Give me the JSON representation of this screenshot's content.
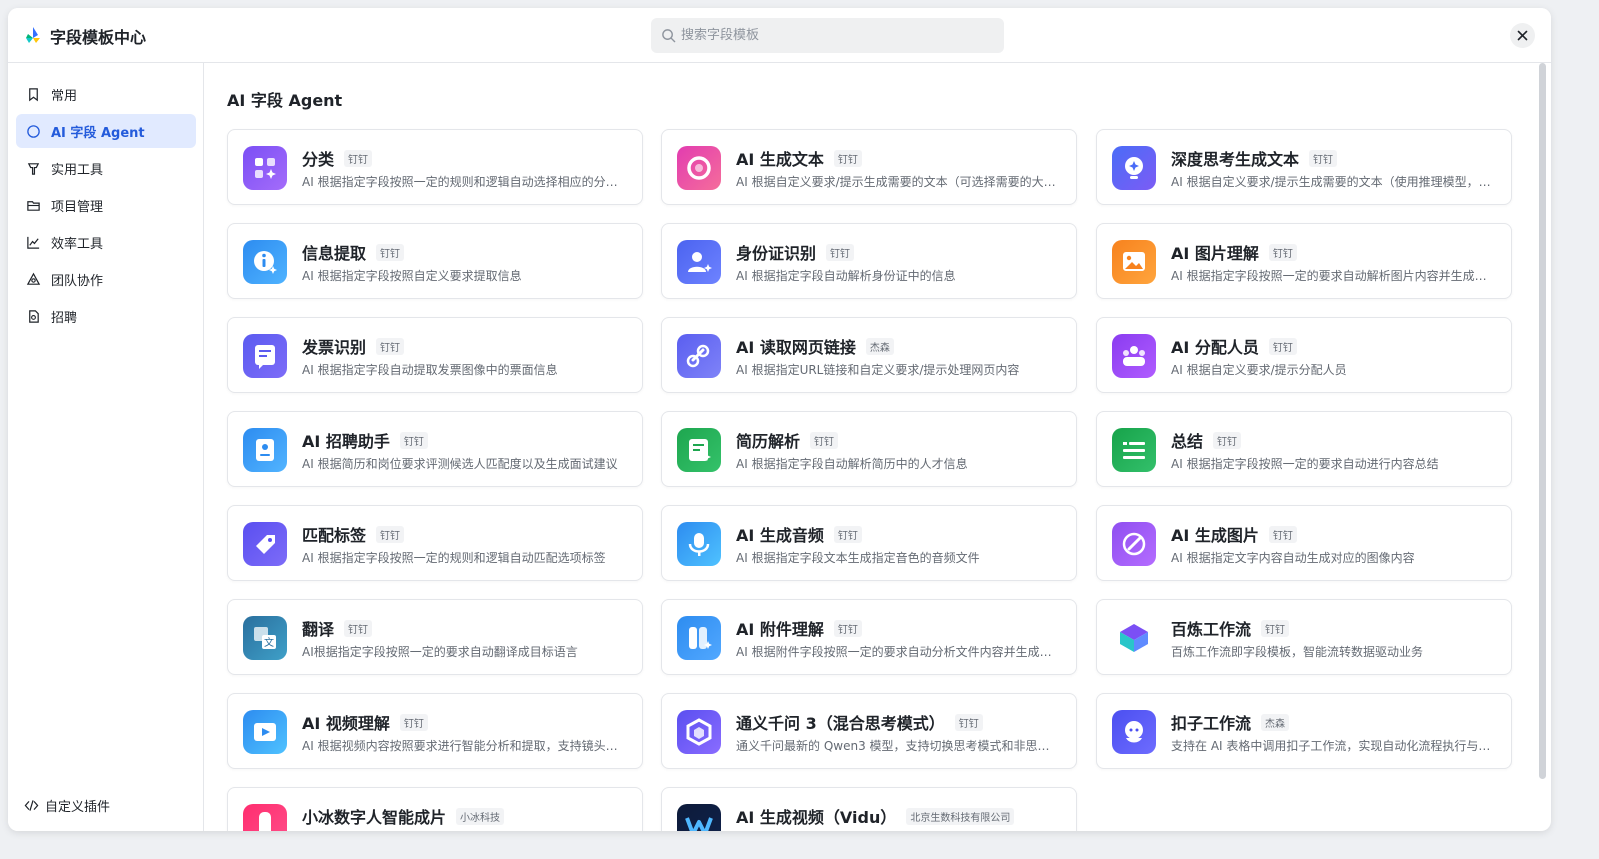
{
  "app": {
    "title": "字段模板中心"
  },
  "search": {
    "placeholder": "搜索字段模板"
  },
  "sidebar": {
    "items": [
      {
        "label": "常用",
        "icon": "bookmark-icon"
      },
      {
        "label": "AI 字段 Agent",
        "icon": "ai-agent-icon",
        "active": true
      },
      {
        "label": "实用工具",
        "icon": "tool-icon"
      },
      {
        "label": "项目管理",
        "icon": "folder-icon"
      },
      {
        "label": "效率工具",
        "icon": "chart-line-icon"
      },
      {
        "label": "团队协作",
        "icon": "team-icon"
      },
      {
        "label": "招聘",
        "icon": "recruit-icon"
      }
    ],
    "custom_plugin": "自定义插件"
  },
  "main": {
    "section_title": "AI 字段 Agent",
    "cards": [
      {
        "title": "分类",
        "badge": "钉钉",
        "desc": "AI 根据指定字段按照一定的规则和逻辑自动选择相应的分类选项",
        "icon": "classify-icon",
        "color1": "#7b4ff5",
        "color2": "#a46cfa"
      },
      {
        "title": "AI 生成文本",
        "badge": "钉钉",
        "desc": "AI 根据自定义要求/提示生成需要的文本（可选择需要的大模型）",
        "icon": "ai-text-icon",
        "color1": "#e23cb0",
        "color2": "#f56d9b"
      },
      {
        "title": "深度思考生成文本",
        "badge": "钉钉",
        "desc": "AI 根据自定义要求/提示生成需要的文本（使用推理模型，可深度思考）",
        "icon": "deep-think-icon",
        "color1": "#4a6cf7",
        "color2": "#7c5cf5"
      },
      {
        "title": "信息提取",
        "badge": "钉钉",
        "desc": "AI 根据指定字段按照自定义要求提取信息",
        "icon": "info-extract-icon",
        "color1": "#2d8cf0",
        "color2": "#4fb3ff"
      },
      {
        "title": "身份证识别",
        "badge": "钉钉",
        "desc": "AI 根据指定字段自动解析身份证中的信息",
        "icon": "id-card-icon",
        "color1": "#4b63f0",
        "color2": "#6e83ff"
      },
      {
        "title": "AI 图片理解",
        "badge": "钉钉",
        "desc": "AI 根据指定字段按照一定的要求自动解析图片内容并生成文本",
        "icon": "image-understand-icon",
        "color1": "#f7821e",
        "color2": "#ffa53d"
      },
      {
        "title": "发票识别",
        "badge": "钉钉",
        "desc": "AI 根据指定字段自动提取发票图像中的票面信息",
        "icon": "invoice-icon",
        "color1": "#5b5bf0",
        "color2": "#7d6cf8"
      },
      {
        "title": "AI 读取网页链接",
        "badge": "杰森",
        "desc": "AI 根据指定URL链接和自定义要求/提示处理网页内容",
        "icon": "link-icon",
        "color1": "#5a5ef0",
        "color2": "#7f83f8"
      },
      {
        "title": "AI 分配人员",
        "badge": "钉钉",
        "desc": "AI 根据自定义要求/提示分配人员",
        "icon": "assign-people-icon",
        "color1": "#8a3cf0",
        "color2": "#b05cff"
      },
      {
        "title": "AI 招聘助手",
        "badge": "钉钉",
        "desc": "AI 根据简历和岗位要求评测候选人匹配度以及生成面试建议",
        "icon": "recruit-assistant-icon",
        "color1": "#2d8cf0",
        "color2": "#52b4ff"
      },
      {
        "title": "简历解析",
        "badge": "钉钉",
        "desc": "AI 根据指定字段自动解析简历中的人才信息",
        "icon": "resume-icon",
        "color1": "#1ea64f",
        "color2": "#34c26a"
      },
      {
        "title": "总结",
        "badge": "钉钉",
        "desc": "AI 根据指定字段按照一定的要求自动进行内容总结",
        "icon": "summary-icon",
        "color1": "#17a34a",
        "color2": "#33c06b"
      },
      {
        "title": "匹配标签",
        "badge": "钉钉",
        "desc": "AI 根据指定字段按照一定的规则和逻辑自动匹配选项标签",
        "icon": "tag-icon",
        "color1": "#5a4ff0",
        "color2": "#7d6cf8"
      },
      {
        "title": "AI 生成音频",
        "badge": "钉钉",
        "desc": "AI 根据指定字段文本生成指定音色的音频文件",
        "icon": "audio-icon",
        "color1": "#2d8cf0",
        "color2": "#4fc2ff"
      },
      {
        "title": "AI 生成图片",
        "badge": "钉钉",
        "desc": "AI 根据指定文字内容自动生成对应的图像内容",
        "icon": "generate-image-icon",
        "color1": "#8f4ff0",
        "color2": "#b46cff"
      },
      {
        "title": "翻译",
        "badge": "钉钉",
        "desc": "AI根据指定字段按照一定的要求自动翻译成目标语言",
        "icon": "translate-icon",
        "color1": "#2a6f9e",
        "color2": "#3fa0c8"
      },
      {
        "title": "AI 附件理解",
        "badge": "钉钉",
        "desc": "AI 根据附件字段按照一定的要求自动分析文件内容并生成文本",
        "icon": "attachment-icon",
        "color1": "#2d8cf0",
        "color2": "#52a8ff"
      },
      {
        "title": "百炼工作流",
        "badge": "钉钉",
        "desc": "百炼工作流即字段模板，智能流转数据驱动业务",
        "icon": "bailian-icon",
        "color1": "#ffffff",
        "color2": "#ffffff"
      },
      {
        "title": "AI 视频理解",
        "badge": "钉钉",
        "desc": "AI 根据视频内容按照要求进行智能分析和提取，支持镜头识别等",
        "icon": "video-understand-icon",
        "color1": "#2d8cf0",
        "color2": "#4fc2ff"
      },
      {
        "title": "通义千问 3（混合思考模式）",
        "badge": "钉钉",
        "desc": "通义千问最新的 Qwen3 模型，支持切换思考模式和非思考模式",
        "icon": "qwen-icon",
        "color1": "#5a4ff0",
        "color2": "#8a6cff"
      },
      {
        "title": "扣子工作流",
        "badge": "杰森",
        "desc": "支持在 AI 表格中调用扣子工作流，实现自动化流程执行与数据处理",
        "icon": "coze-icon",
        "color1": "#4b4ff0",
        "color2": "#6e6cff"
      },
      {
        "title": "小冰数字人智能成片",
        "badge": "小冰科技",
        "desc": "",
        "icon": "xiaoice-icon",
        "color1": "#ff2d6f",
        "color2": "#ff4f8a"
      },
      {
        "title": "AI 生成视频（Vidu）",
        "badge": "北京生数科技有限公司",
        "desc": "",
        "icon": "vidu-icon",
        "color1": "#0d1b3a",
        "color2": "#10214a"
      }
    ]
  }
}
